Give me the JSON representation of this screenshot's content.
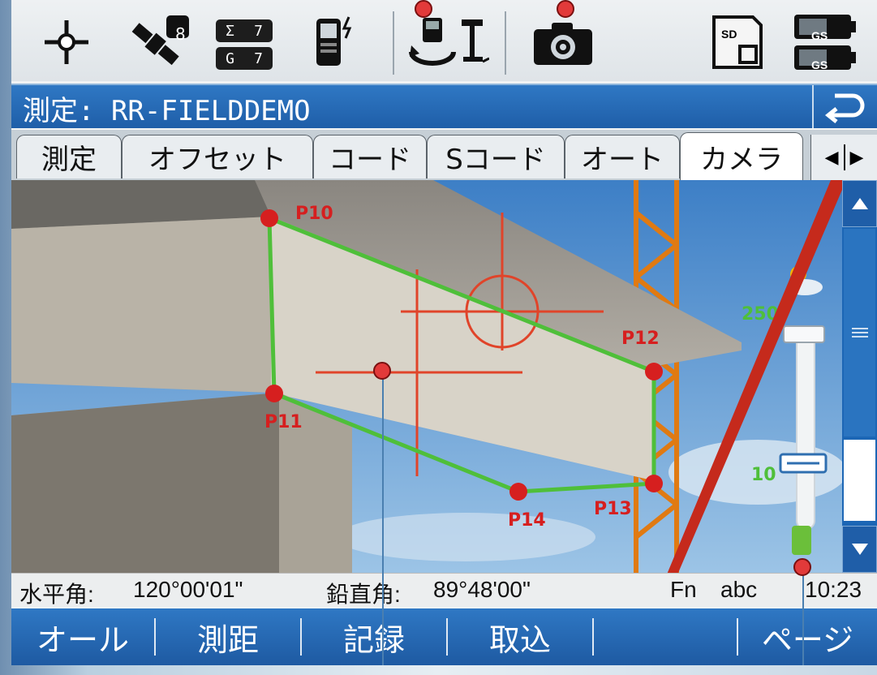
{
  "statusbar": {
    "sat_count": "8",
    "sum_label": "Σ",
    "sum_value": "7",
    "glonass_label": "G",
    "glonass_value": "7",
    "sd_label": "SD",
    "battery_labels": [
      "GS",
      "GS"
    ],
    "icons": [
      "crosshair-icon",
      "satellite-icon",
      "sum-icon",
      "controller-icon",
      "instrument-rotate-icon",
      "camera-icon",
      "sd-card-icon",
      "battery-icon"
    ]
  },
  "titlebar": {
    "title": "測定: RR-FIELDDEMO",
    "back_icon": "back-arrow-icon"
  },
  "tabs": [
    {
      "label": "測定",
      "active": false
    },
    {
      "label": "オフセット",
      "active": false
    },
    {
      "label": "コード",
      "active": false
    },
    {
      "label": "Sコード",
      "active": false
    },
    {
      "label": "オート",
      "active": false
    },
    {
      "label": "カメラ",
      "active": true
    }
  ],
  "tab_scroll": {
    "left": "◀",
    "right": "▶"
  },
  "camera": {
    "points": [
      "P10",
      "P11",
      "P12",
      "P13",
      "P14"
    ],
    "zoom_high": "250",
    "zoom_low": "10"
  },
  "infobar": {
    "hz_label": "水平角:",
    "hz_value": "120°00'01\"",
    "v_label": "鉛直角:",
    "v_value": "89°48'00\"",
    "fn": "Fn",
    "mode": "abc",
    "time": "10:23"
  },
  "softkeys": [
    "オール",
    "測距",
    "記録",
    "取込",
    "",
    "ページ"
  ],
  "colors": {
    "title_blue": "#1f5ea8",
    "polygon_green": "#4fbf3a",
    "point_red": "#d61f1f",
    "crosshair_red": "#e0442a"
  }
}
